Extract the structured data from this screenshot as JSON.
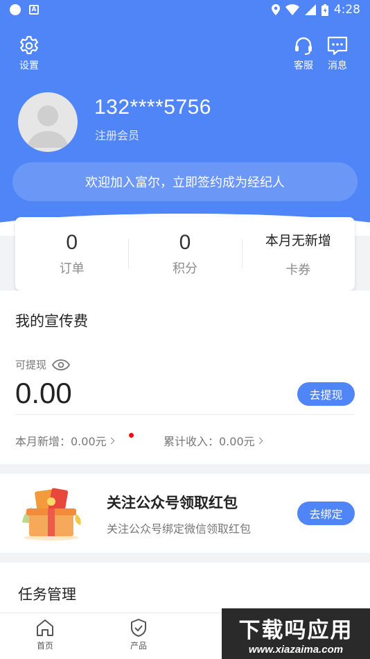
{
  "status_bar": {
    "time": "4:28"
  },
  "header": {
    "settings_label": "设置",
    "service_label": "客服",
    "messages_label": "消息",
    "phone": "132****5756",
    "member_status": "注册会员",
    "welcome_text": "欢迎加入富尔，立即签约成为经纪人"
  },
  "stats": [
    {
      "value": "0",
      "label": "订单"
    },
    {
      "value": "0",
      "label": "积分"
    },
    {
      "value": "本月无新增",
      "label": "卡券"
    }
  ],
  "fees": {
    "title": "我的宣传费",
    "withdrawable_label": "可提现",
    "amount": "0.00",
    "withdraw_button": "去提现",
    "month_added": "本月新增：0.00元",
    "total_income": "累计收入：0.00元"
  },
  "promo": {
    "title": "关注公众号领取红包",
    "subtitle": "关注公众号绑定微信领取红包",
    "bind_button": "去绑定"
  },
  "tasks": {
    "title": "任务管理"
  },
  "tabbar": {
    "home": "首页",
    "products": "产品"
  },
  "watermark": {
    "big": "下载吗应用",
    "small": "www.xiazaima.com"
  },
  "colors": {
    "primary": "#4f85f6",
    "background": "#f2f3f5",
    "dot": "#ee1111"
  }
}
